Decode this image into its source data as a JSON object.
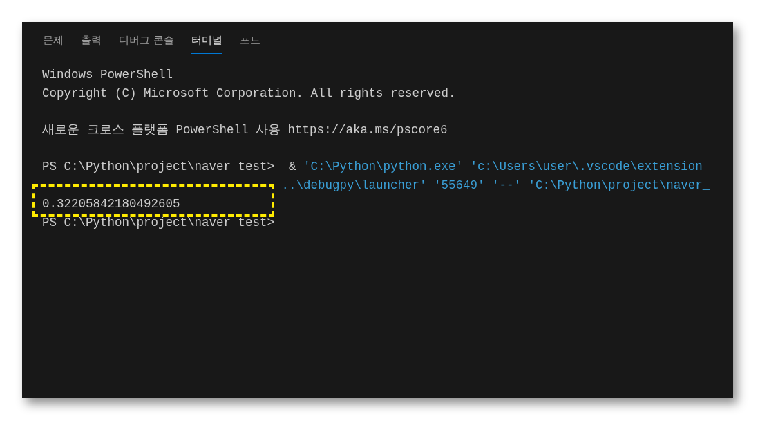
{
  "tabs": [
    {
      "label": "문제",
      "selected": false
    },
    {
      "label": "출력",
      "selected": false
    },
    {
      "label": "디버그 콘솔",
      "selected": false
    },
    {
      "label": "터미널",
      "selected": true
    },
    {
      "label": "포트",
      "selected": false
    }
  ],
  "terminal": {
    "lines": [
      {
        "kind": "text",
        "highlighted": false,
        "start_hidden": false,
        "parts": [
          {
            "kind": "plain",
            "text": "Windows PowerShell"
          }
        ]
      },
      {
        "kind": "text",
        "highlighted": false,
        "start_hidden": false,
        "parts": [
          {
            "kind": "plain",
            "text": "Copyright (C) Microsoft Corporation. All rights reserved."
          }
        ]
      },
      {
        "kind": "blank"
      },
      {
        "kind": "text",
        "highlighted": false,
        "start_hidden": false,
        "parts": [
          {
            "kind": "plain",
            "text": "새로운 크로스 플랫폼 PowerShell 사용 https://aka.ms/pscore6"
          }
        ]
      },
      {
        "kind": "blank"
      },
      {
        "kind": "text",
        "highlighted": false,
        "start_hidden": false,
        "parts": [
          {
            "kind": "plain",
            "text": "PS C:\\Python\\project\\naver_test>  & "
          },
          {
            "kind": "string",
            "text": "'C:\\Python\\python.exe' 'c:\\Users\\user\\.vscode\\extension"
          }
        ]
      },
      {
        "kind": "text",
        "highlighted": false,
        "start_hidden": true,
        "parts": [
          {
            "kind": "string",
            "text": "..\\debugpy\\launcher' '55649' '--' 'C:\\Python\\project\\naver_"
          }
        ]
      },
      {
        "kind": "text",
        "highlighted": true,
        "start_hidden": false,
        "parts": [
          {
            "kind": "plain",
            "text": "0.32205842180492605"
          }
        ]
      },
      {
        "kind": "text",
        "highlighted": false,
        "start_hidden": false,
        "parts": [
          {
            "kind": "plain",
            "text": "PS C:\\Python\\project\\naver_test>"
          }
        ]
      }
    ]
  }
}
